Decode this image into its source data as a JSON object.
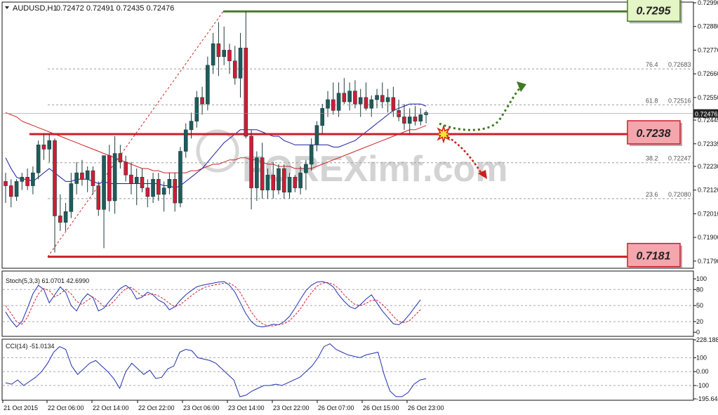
{
  "header": {
    "symbol_tf": "AUDUSD,H1",
    "ohlc": "0.72472 0.72491 0.72435 0.72476"
  },
  "watermark": "FOREXimf.com",
  "colors": {
    "bull": "#1e5c5c",
    "bear": "#d01c34",
    "ma_fast": "#1a1aa8",
    "ma_slow": "#cc2222",
    "fib_line": "#9a9a9a",
    "level_red": "#cc1f2a",
    "level_green": "#4a7a2a",
    "label_red_fill": "#f4a6ad",
    "label_green_fill": "#e4f5c6",
    "arrow_green": "#3f7a23",
    "arrow_red": "#c81e1e",
    "stoch_main": "#1f2fb0",
    "stoch_signal": "#d01c34",
    "cci_line": "#1f2fb0"
  },
  "chart_data": [
    {
      "type": "candlestick",
      "title": "AUDUSD,H1",
      "ylim": [
        0.7176,
        0.7299
      ],
      "y_ticks": [
        "0.72990",
        "0.72880",
        "0.72770",
        "0.72660",
        "0.72550",
        "0.72445",
        "0.72335",
        "0.72230",
        "0.72120",
        "0.72010",
        "0.71900",
        "0.71790"
      ],
      "current_price": "0.72476",
      "x_ticks": [
        "21 Oct 2015",
        "22 Oct 06:00",
        "22 Oct 14:00",
        "22 Oct 22:00",
        "23 Oct 06:00",
        "23 Oct 14:00",
        "23 Oct 22:00",
        "26 Oct 07:00",
        "26 Oct 15:00",
        "26 Oct 23:00"
      ],
      "fib_levels": [
        {
          "label": "76.4",
          "value": "0.72683",
          "price": 0.72683
        },
        {
          "label": "61.8",
          "value": "0.72516",
          "price": 0.72516
        },
        {
          "label": "38.2",
          "value": "0.72247",
          "price": 0.72247
        },
        {
          "label": "23.6",
          "value": "0.72080",
          "price": 0.7208
        }
      ],
      "levels": [
        {
          "label": "0.7295",
          "price": 0.7295,
          "kind": "resistance"
        },
        {
          "label": "0.7238",
          "price": 0.7238,
          "kind": "breakout"
        },
        {
          "label": "0.7181",
          "price": 0.7181,
          "kind": "support"
        }
      ],
      "fib_anchor": {
        "from": 0.7181,
        "to": 0.7295
      },
      "ohlc": [
        [
          0.7216,
          0.722,
          0.7206,
          0.7214
        ],
        [
          0.7214,
          0.7217,
          0.7204,
          0.7209
        ],
        [
          0.7209,
          0.7217,
          0.7207,
          0.7216
        ],
        [
          0.7216,
          0.722,
          0.7212,
          0.7218
        ],
        [
          0.7218,
          0.7222,
          0.7212,
          0.7214
        ],
        [
          0.7214,
          0.7223,
          0.721,
          0.722
        ],
        [
          0.722,
          0.7235,
          0.7217,
          0.7233
        ],
        [
          0.7233,
          0.7238,
          0.7226,
          0.7231
        ],
        [
          0.7231,
          0.7238,
          0.7225,
          0.7235
        ],
        [
          0.7235,
          0.7236,
          0.7183,
          0.72
        ],
        [
          0.72,
          0.721,
          0.7193,
          0.7197
        ],
        [
          0.7197,
          0.7206,
          0.7193,
          0.7202
        ],
        [
          0.7202,
          0.722,
          0.7199,
          0.7215
        ],
        [
          0.7215,
          0.7225,
          0.721,
          0.722
        ],
        [
          0.722,
          0.7226,
          0.7214,
          0.7217
        ],
        [
          0.7217,
          0.7223,
          0.7211,
          0.7221
        ],
        [
          0.7221,
          0.7223,
          0.721,
          0.7214
        ],
        [
          0.7214,
          0.7216,
          0.72,
          0.7203
        ],
        [
          0.7203,
          0.7216,
          0.7185,
          0.7228
        ],
        [
          0.7228,
          0.7233,
          0.7202,
          0.7207
        ],
        [
          0.7207,
          0.7237,
          0.7201,
          0.7229
        ],
        [
          0.7229,
          0.7233,
          0.7222,
          0.7225
        ],
        [
          0.7225,
          0.7228,
          0.7216,
          0.7219
        ],
        [
          0.7219,
          0.7225,
          0.721,
          0.7215
        ],
        [
          0.7215,
          0.7222,
          0.7205,
          0.7218
        ],
        [
          0.7218,
          0.7222,
          0.7211,
          0.7213
        ],
        [
          0.7213,
          0.7217,
          0.7204,
          0.7209
        ],
        [
          0.7209,
          0.722,
          0.7206,
          0.7217
        ],
        [
          0.7217,
          0.722,
          0.7207,
          0.721
        ],
        [
          0.721,
          0.7216,
          0.7202,
          0.7213
        ],
        [
          0.7213,
          0.722,
          0.721,
          0.7217
        ],
        [
          0.7217,
          0.722,
          0.7202,
          0.7206
        ],
        [
          0.7206,
          0.7232,
          0.7204,
          0.723
        ],
        [
          0.723,
          0.7243,
          0.7227,
          0.724
        ],
        [
          0.724,
          0.7248,
          0.7236,
          0.7244
        ],
        [
          0.7244,
          0.7258,
          0.7241,
          0.7255
        ],
        [
          0.7255,
          0.726,
          0.7247,
          0.7252
        ],
        [
          0.7252,
          0.7274,
          0.7249,
          0.727
        ],
        [
          0.727,
          0.7285,
          0.7266,
          0.728
        ],
        [
          0.728,
          0.729,
          0.7265,
          0.7274
        ],
        [
          0.7274,
          0.7288,
          0.727,
          0.7277
        ],
        [
          0.7277,
          0.728,
          0.7266,
          0.7272
        ],
        [
          0.7272,
          0.7279,
          0.7261,
          0.7264
        ],
        [
          0.7264,
          0.7285,
          0.7255,
          0.7278
        ],
        [
          0.7278,
          0.7295,
          0.7236,
          0.7237
        ],
        [
          0.7237,
          0.724,
          0.7203,
          0.7213
        ],
        [
          0.7213,
          0.723,
          0.7207,
          0.7227
        ],
        [
          0.7227,
          0.7234,
          0.7208,
          0.7212
        ],
        [
          0.7212,
          0.7222,
          0.7208,
          0.7219
        ],
        [
          0.7219,
          0.7225,
          0.7208,
          0.7212
        ],
        [
          0.7212,
          0.7224,
          0.721,
          0.7222
        ],
        [
          0.7222,
          0.7224,
          0.7208,
          0.7211
        ],
        [
          0.7211,
          0.722,
          0.7208,
          0.7218
        ],
        [
          0.7218,
          0.7219,
          0.7211,
          0.7213
        ],
        [
          0.7213,
          0.7223,
          0.721,
          0.722
        ],
        [
          0.722,
          0.7226,
          0.7212,
          0.7224
        ],
        [
          0.7224,
          0.7236,
          0.7221,
          0.7233
        ],
        [
          0.7233,
          0.7244,
          0.723,
          0.7242
        ],
        [
          0.7242,
          0.7252,
          0.7238,
          0.725
        ],
        [
          0.725,
          0.7258,
          0.7246,
          0.7254
        ],
        [
          0.7254,
          0.7262,
          0.7247,
          0.7249
        ],
        [
          0.7249,
          0.7262,
          0.7246,
          0.7257
        ],
        [
          0.7257,
          0.7264,
          0.7252,
          0.7253
        ],
        [
          0.7253,
          0.7262,
          0.7249,
          0.7258
        ],
        [
          0.7258,
          0.7263,
          0.725,
          0.7252
        ],
        [
          0.7252,
          0.7259,
          0.7246,
          0.7255
        ],
        [
          0.7255,
          0.7262,
          0.7249,
          0.725
        ],
        [
          0.725,
          0.7256,
          0.7246,
          0.7254
        ],
        [
          0.7254,
          0.7259,
          0.725,
          0.7256
        ],
        [
          0.7256,
          0.7262,
          0.725,
          0.7253
        ],
        [
          0.7253,
          0.7259,
          0.7248,
          0.7255
        ],
        [
          0.7255,
          0.726,
          0.7246,
          0.7249
        ],
        [
          0.7249,
          0.7254,
          0.7244,
          0.7246
        ],
        [
          0.7246,
          0.7252,
          0.724,
          0.7243
        ],
        [
          0.7243,
          0.725,
          0.7238,
          0.7246
        ],
        [
          0.7246,
          0.7251,
          0.7242,
          0.7244
        ],
        [
          0.7244,
          0.725,
          0.7242,
          0.7247
        ],
        [
          0.7247,
          0.7249,
          0.7243,
          0.7248
        ]
      ],
      "ma_fast": [
        0.7227,
        0.7222,
        0.7218,
        0.7217,
        0.7217,
        0.7216,
        0.7218,
        0.722,
        0.7222,
        0.722,
        0.7218,
        0.7216,
        0.7216,
        0.7217,
        0.7217,
        0.7217,
        0.7216,
        0.7215,
        0.7216,
        0.7215,
        0.7215,
        0.7215,
        0.7215,
        0.7215,
        0.7215,
        0.7215,
        0.7215,
        0.7215,
        0.7215,
        0.7214,
        0.7214,
        0.7213,
        0.7214,
        0.7216,
        0.7218,
        0.722,
        0.7222,
        0.7225,
        0.7228,
        0.7231,
        0.7234,
        0.7236,
        0.7238,
        0.724,
        0.724,
        0.724,
        0.724,
        0.7239,
        0.7238,
        0.7237,
        0.7237,
        0.7235,
        0.7234,
        0.7233,
        0.7233,
        0.7233,
        0.7233,
        0.7233,
        0.7233,
        0.7233,
        0.7232,
        0.7232,
        0.7233,
        0.7234,
        0.7235,
        0.7237,
        0.7239,
        0.7241,
        0.7243,
        0.7245,
        0.7247,
        0.7249,
        0.725,
        0.7251,
        0.7252,
        0.7252,
        0.7252,
        0.7251
      ],
      "ma_slow": [
        0.7248,
        0.7247,
        0.7246,
        0.7244,
        0.7243,
        0.7242,
        0.7241,
        0.724,
        0.7239,
        0.7238,
        0.7237,
        0.7236,
        0.7235,
        0.7234,
        0.7233,
        0.7232,
        0.7231,
        0.723,
        0.7229,
        0.7228,
        0.7227,
        0.7226,
        0.7225,
        0.7224,
        0.7223,
        0.7222,
        0.7222,
        0.7221,
        0.7221,
        0.722,
        0.722,
        0.722,
        0.722,
        0.722,
        0.7221,
        0.7221,
        0.7222,
        0.7223,
        0.7224,
        0.7224,
        0.7225,
        0.7226,
        0.7226,
        0.7227,
        0.7227,
        0.7226,
        0.7226,
        0.7225,
        0.7224,
        0.7224,
        0.7223,
        0.7223,
        0.7223,
        0.7222,
        0.7222,
        0.7222,
        0.7222,
        0.7223,
        0.7224,
        0.7225,
        0.7226,
        0.7227,
        0.7228,
        0.7229,
        0.723,
        0.7231,
        0.7232,
        0.7233,
        0.7234,
        0.7235,
        0.7236,
        0.7237,
        0.7238,
        0.7239,
        0.724,
        0.724,
        0.7241,
        0.7242
      ]
    },
    {
      "type": "line",
      "title": "Stoch(5,3,3) 61.0701 42.6990",
      "ylim": [
        0,
        100
      ],
      "y_ticks": [
        "100",
        "80",
        "50",
        "20",
        "0"
      ],
      "series": [
        {
          "name": "61.0701",
          "values": [
            38,
            22,
            10,
            20,
            45,
            72,
            88,
            80,
            55,
            70,
            85,
            75,
            50,
            40,
            60,
            72,
            65,
            40,
            45,
            58,
            70,
            82,
            88,
            80,
            62,
            66,
            75,
            70,
            60,
            55,
            42,
            48,
            60,
            70,
            78,
            85,
            88,
            90,
            92,
            94,
            95,
            88,
            75,
            55,
            35,
            20,
            12,
            10,
            12,
            15,
            14,
            20,
            30,
            45,
            62,
            78,
            88,
            94,
            95,
            92,
            85,
            70,
            58,
            48,
            44,
            52,
            62,
            70,
            55,
            40,
            28,
            16,
            14,
            22,
            34,
            48,
            61
          ]
        },
        {
          "name": "42.6990",
          "values": [
            50,
            35,
            20,
            15,
            28,
            52,
            72,
            82,
            78,
            66,
            72,
            80,
            72,
            58,
            52,
            60,
            66,
            58,
            48,
            50,
            60,
            72,
            82,
            84,
            76,
            68,
            70,
            72,
            68,
            62,
            54,
            48,
            52,
            60,
            68,
            76,
            82,
            86,
            88,
            90,
            92,
            92,
            86,
            74,
            56,
            38,
            24,
            16,
            12,
            12,
            14,
            16,
            22,
            32,
            44,
            60,
            74,
            86,
            92,
            93,
            90,
            82,
            70,
            60,
            52,
            50,
            54,
            60,
            60,
            52,
            42,
            30,
            20,
            18,
            22,
            32,
            42.7
          ]
        }
      ]
    },
    {
      "type": "line",
      "title": "CCI(14) -51.0134",
      "ylim": [
        -195.6456,
        228.1884
      ],
      "y_ticks": [
        "228.1884",
        "100",
        "0.00",
        "-100",
        "-195.6456"
      ],
      "series": [
        {
          "name": "-51.0134",
          "values": [
            -80,
            -90,
            -60,
            -100,
            -70,
            -40,
            0,
            60,
            140,
            180,
            160,
            40,
            -20,
            20,
            60,
            80,
            40,
            0,
            -50,
            -120,
            0,
            60,
            20,
            -20,
            10,
            -50,
            -40,
            20,
            40,
            140,
            160,
            150,
            100,
            90,
            80,
            60,
            20,
            -20,
            -60,
            -180,
            -170,
            -140,
            -120,
            -100,
            -100,
            -90,
            -100,
            -80,
            -60,
            -40,
            0,
            40,
            100,
            180,
            200,
            160,
            140,
            120,
            110,
            100,
            120,
            130,
            140,
            -20,
            -140,
            -180,
            -180,
            -150,
            -90,
            -60,
            -51
          ]
        }
      ]
    }
  ]
}
